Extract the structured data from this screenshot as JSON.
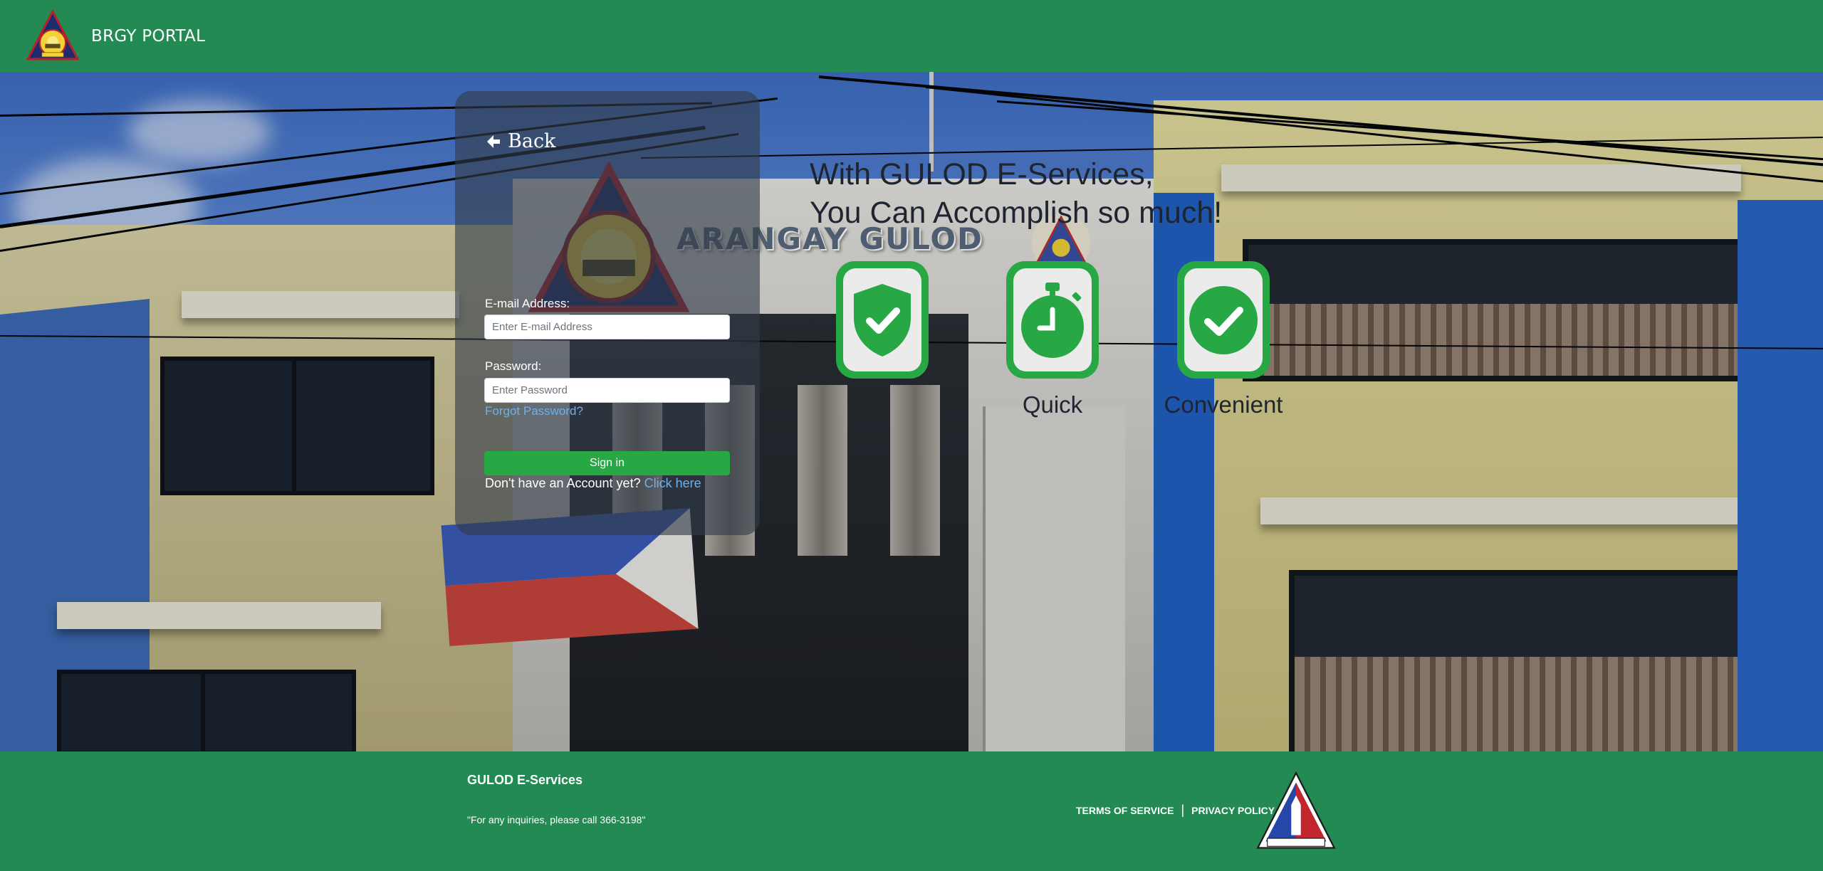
{
  "nav": {
    "brand": "BRGY PORTAL"
  },
  "hero": {
    "sign_text": "ARANGAY GULOD"
  },
  "login": {
    "back_label": "Back",
    "email_label": "E-mail Address:",
    "email_placeholder": "Enter E-mail Address",
    "email_value": "",
    "password_label": "Password:",
    "password_placeholder": "Enter Password",
    "password_value": "",
    "forgot_label": "Forgot Password?",
    "signin_label": "Sign in",
    "register_prompt": "Don't have an Account yet?",
    "register_link": "Click here"
  },
  "tagline": {
    "line1": "With GULOD E-Services,",
    "line2": "You Can Accomplish so much!"
  },
  "features": [
    {
      "icon": "shield-check-icon",
      "label": ""
    },
    {
      "icon": "stopwatch-icon",
      "label": "Quick"
    },
    {
      "icon": "check-circle-icon",
      "label": "Convenient"
    }
  ],
  "footer": {
    "title": "GULOD E-Services",
    "note": "\"For any inquiries, please call 366-3198\"",
    "terms": "TERMS OF SERVICE",
    "separator": "|",
    "privacy": "PRIVACY POLICY"
  },
  "colors": {
    "primary_green": "#228a52",
    "button_green": "#28a745",
    "link_blue": "#6fb0ea",
    "card_overlay": "rgba(50,60,72,0.62)"
  }
}
